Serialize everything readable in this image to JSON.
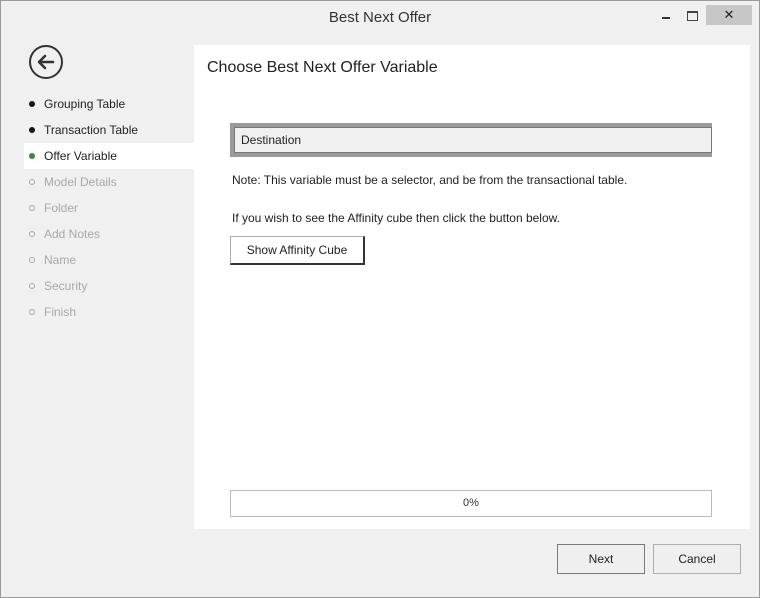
{
  "window": {
    "title": "Best Next Offer",
    "controls": {
      "minimize_icon": "minimize-icon",
      "maximize_icon": "maximize-icon",
      "close_label": "✕"
    }
  },
  "sidebar": {
    "back_icon": "back-arrow-icon",
    "steps": [
      {
        "label": "Grouping Table",
        "state": "done"
      },
      {
        "label": "Transaction Table",
        "state": "done"
      },
      {
        "label": "Offer Variable",
        "state": "active"
      },
      {
        "label": "Model Details",
        "state": "disabled"
      },
      {
        "label": "Folder",
        "state": "disabled"
      },
      {
        "label": "Add Notes",
        "state": "disabled"
      },
      {
        "label": "Name",
        "state": "disabled"
      },
      {
        "label": "Security",
        "state": "disabled"
      },
      {
        "label": "Finish",
        "state": "disabled"
      }
    ]
  },
  "main": {
    "title": "Choose Best Next Offer Variable",
    "selected_variable": "Destination",
    "note": "Note: This variable must be a selector, and be from the transactional table.",
    "hint": "If you wish to see the Affinity cube then click the button below.",
    "affinity_button": "Show Affinity Cube",
    "progress": {
      "value": 0,
      "label": "0%"
    }
  },
  "footer": {
    "next_label": "Next",
    "cancel_label": "Cancel"
  },
  "colors": {
    "active_dot": "#3a8a3a",
    "disabled_text": "#a8a8a8",
    "close_button_bg": "#c7c7c7"
  }
}
